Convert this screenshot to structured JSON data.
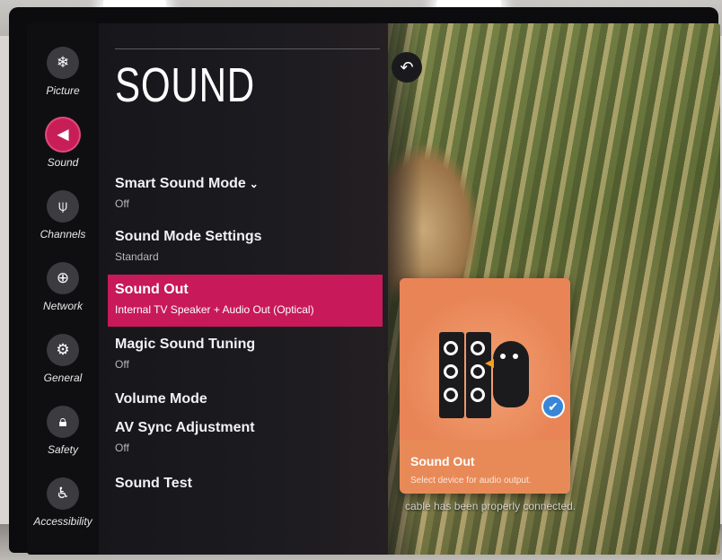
{
  "sidebar": {
    "items": [
      {
        "label": "Picture",
        "icon": "picture-icon",
        "glyph": "❄",
        "active": false
      },
      {
        "label": "Sound",
        "icon": "speaker-icon",
        "glyph": "◀",
        "active": true
      },
      {
        "label": "Channels",
        "icon": "antenna-icon",
        "glyph": "⍦",
        "active": false
      },
      {
        "label": "Network",
        "icon": "globe-icon",
        "glyph": "⊕",
        "active": false
      },
      {
        "label": "General",
        "icon": "tools-icon",
        "glyph": "⚙",
        "active": false
      },
      {
        "label": "Safety",
        "icon": "lock-icon",
        "glyph": "🔒︎",
        "active": false
      },
      {
        "label": "Accessibility",
        "icon": "accessibility-icon",
        "glyph": "♿︎",
        "active": false
      }
    ]
  },
  "page": {
    "title": "SOUND"
  },
  "menu": {
    "items": [
      {
        "label": "Smart Sound Mode",
        "value": "Off",
        "has_chevron": true
      },
      {
        "label": "Sound Mode Settings",
        "value": "Standard"
      },
      {
        "label": "Sound Out",
        "value": "Internal TV Speaker + Audio Out (Optical)",
        "selected": true
      },
      {
        "label": "Magic Sound Tuning",
        "value": "Off"
      },
      {
        "label": "Volume Mode",
        "value": ""
      },
      {
        "label": "AV Sync Adjustment",
        "value": "Off"
      },
      {
        "label": "Sound Test",
        "value": ""
      }
    ],
    "chevron": "⌄"
  },
  "back": {
    "glyph": "↶",
    "icon": "back-icon"
  },
  "card": {
    "title": "Sound Out",
    "description": "Select device for audio output.",
    "check_glyph": "✔"
  },
  "notice": {
    "line1": "cable has been properly connected."
  },
  "colors": {
    "accent": "#c8195a",
    "card": "#e88a58",
    "check": "#3a86d6"
  }
}
